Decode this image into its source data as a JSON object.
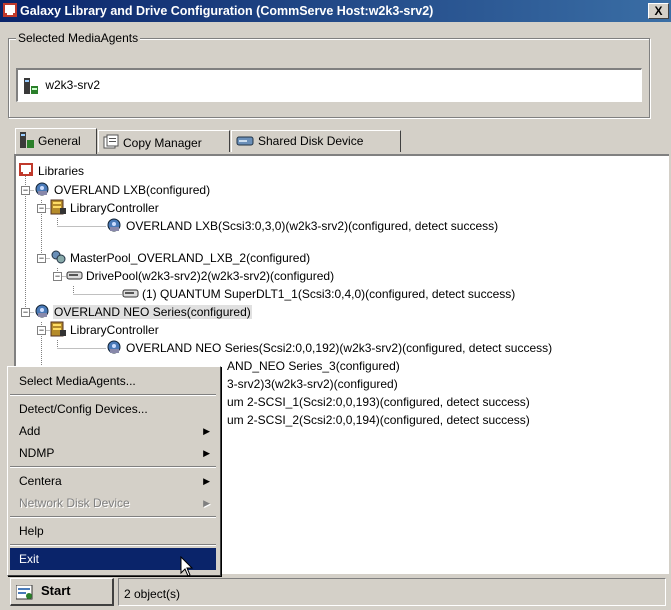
{
  "window": {
    "title": "Galaxy Library and Drive Configuration (CommServe Host:w2k3-srv2)",
    "close_label": "X"
  },
  "media_agents": {
    "group_label": "Selected MediaAgents",
    "items": [
      "w2k3-srv2"
    ]
  },
  "tabs": [
    {
      "label": "General",
      "icon": "server-icon"
    },
    {
      "label": "Copy Manager",
      "icon": "copy-manager-icon"
    },
    {
      "label": "Shared Disk Device",
      "icon": "shared-disk-icon"
    }
  ],
  "tree": {
    "root": "Libraries",
    "n1": "OVERLAND LXB(configured)",
    "n2": "LibraryController",
    "n3": "OVERLAND LXB(Scsi3:0,3,0)(w2k3-srv2)(configured, detect success)",
    "n4": "MasterPool_OVERLAND_LXB_2(configured)",
    "n5": "DrivePool(w2k3-srv2)2(w2k3-srv2)(configured)",
    "n6": "(1) QUANTUM SuperDLT1_1(Scsi3:0,4,0)(configured, detect success)",
    "n7": "OVERLAND NEO Series(configured)",
    "n8": "LibraryController",
    "n9": "OVERLAND NEO Series(Scsi2:0,0,192)(w2k3-srv2)(configured, detect success)",
    "n10": "AND_NEO Series_3(configured)",
    "n11": "3-srv2)3(w2k3-srv2)(configured)",
    "n12": "um 2-SCSI_1(Scsi2:0,0,193)(configured, detect success)",
    "n13": "um 2-SCSI_2(Scsi2:0,0,194)(configured, detect success)"
  },
  "context_menu": {
    "select_media_agents": "Select MediaAgents...",
    "detect_config": "Detect/Config Devices...",
    "add": "Add",
    "ndmp": "NDMP",
    "centera": "Centera",
    "network_disk": "Network Disk Device",
    "help": "Help",
    "exit": "Exit"
  },
  "status_bar": {
    "start_label": "Start",
    "object_count": "2 object(s)"
  },
  "colors": {
    "title_bar": "#0a246a",
    "menu_highlight": "#0a246a",
    "window_bg": "#d4d0c8"
  }
}
